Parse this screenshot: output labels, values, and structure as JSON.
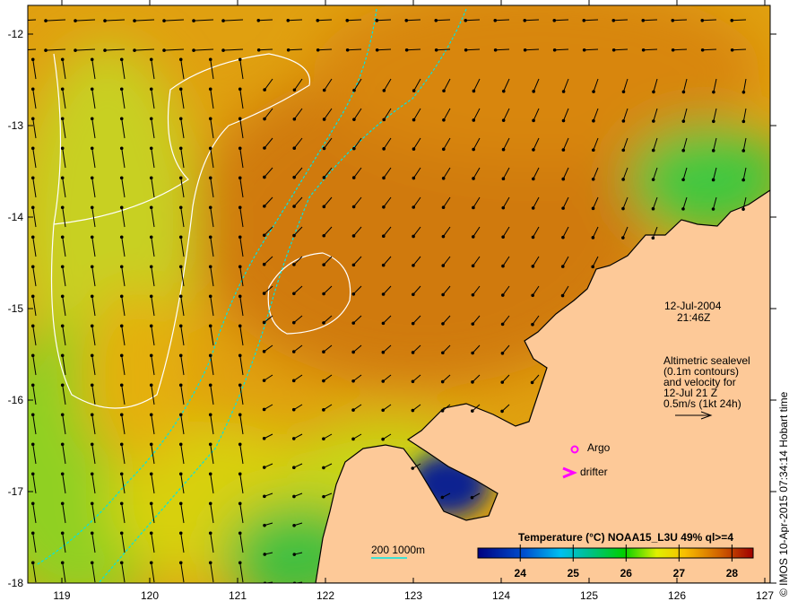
{
  "map": {
    "x_ticks": [
      "119",
      "120",
      "121",
      "122",
      "123",
      "124",
      "125",
      "126",
      "127"
    ],
    "y_ticks": [
      "-12",
      "-13",
      "-14",
      "-15",
      "-16",
      "-17",
      "-18"
    ],
    "lon_range": [
      118.62,
      127.06
    ],
    "lat_range": [
      -18,
      -11.68
    ],
    "date": "12-Jul-2004",
    "time": "21:46Z",
    "altimetry_note": [
      "Altimetric sealevel",
      "(0.1m contours)",
      "and velocity for",
      "12-Jul 21 Z",
      "0.5m/s (1kt 24h)"
    ],
    "legend_argo": "Argo",
    "legend_drifter": "drifter",
    "bathymetry_label": "200  1000m",
    "colorbar_title": "Temperature (°C) NOAA15_L3U 49% ql>=4",
    "colorbar_ticks": [
      "24",
      "25",
      "26",
      "27",
      "28"
    ],
    "colorbar_range": [
      23.2,
      28.4
    ],
    "credit": "© IMOS 10-Apr-2015 07:34:14 Hobart time",
    "colors": {
      "land": "#fdc998",
      "warm": "#d4820a",
      "mid": "#e8c000",
      "cool": "#3cc040",
      "contour": "#00e5e5",
      "marker": "#ff00ff"
    }
  }
}
